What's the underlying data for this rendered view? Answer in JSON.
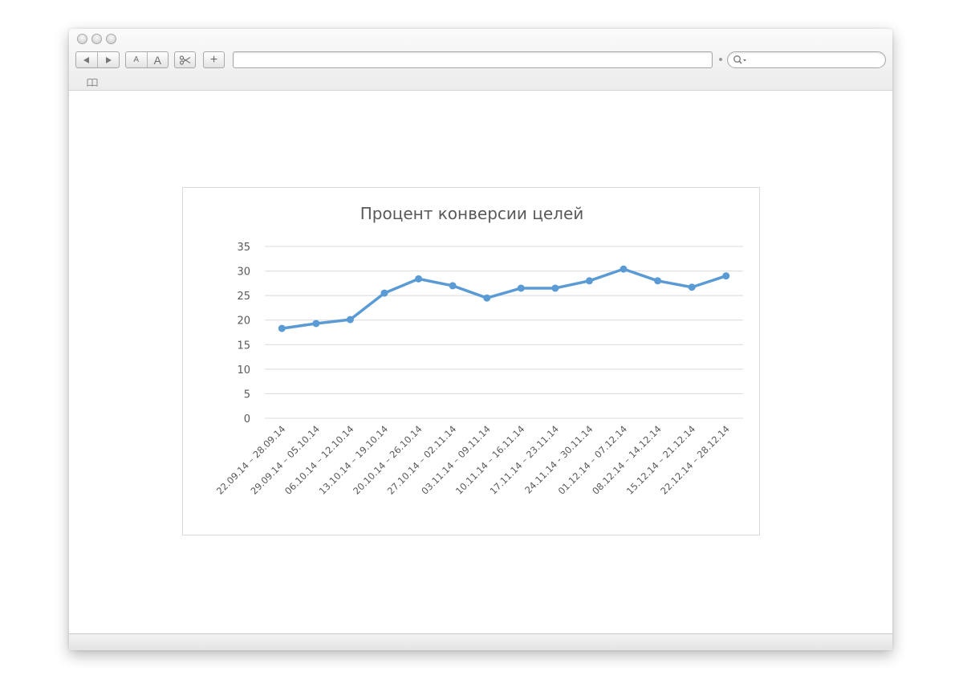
{
  "browser": {
    "font_size_small_label": "A",
    "font_size_large_label": "A",
    "add_tab_label": "+"
  },
  "chart_data": {
    "type": "line",
    "title": "Процент конверсии целей",
    "categories": [
      "22.09.14 – 28.09.14",
      "29.09.14 – 05.10.14",
      "06.10.14 – 12.10.14",
      "13.10.14 – 19.10.14",
      "20.10.14 – 26.10.14",
      "27.10.14 – 02.11.14",
      "03.11.14 – 09.11.14",
      "10.11.14 – 16.11.14",
      "17.11.14 – 23.11.14",
      "24.11.14 - 30.11.14",
      "01.12.14 – 07.12.14",
      "08.12.14 – 14.12.14",
      "15.12.14 – 21.12.14",
      "22.12.14 – 28.12.14"
    ],
    "values": [
      18.3,
      19.3,
      20.1,
      25.5,
      28.4,
      27.0,
      24.5,
      26.5,
      26.5,
      28.0,
      30.4,
      28.0,
      26.7,
      29.0
    ],
    "yticks": [
      "0",
      "5",
      "10",
      "15",
      "20",
      "25",
      "30",
      "35"
    ],
    "ylim": [
      0,
      35
    ],
    "xlabel": "",
    "ylabel": "",
    "grid": true,
    "line_color": "#5b9bd5",
    "grid_color": "#d9d9d9"
  }
}
